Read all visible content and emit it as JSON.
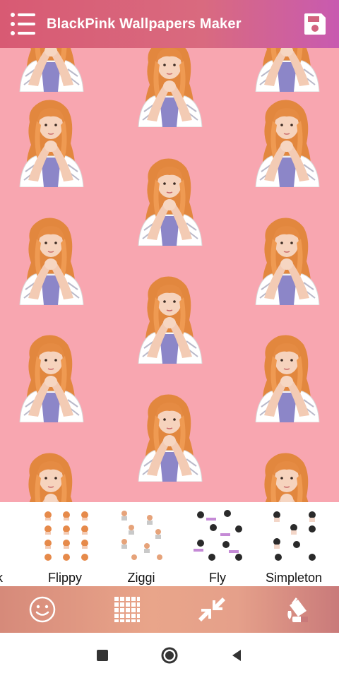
{
  "app": {
    "title": "BlackPink Wallpapers Maker"
  },
  "icons": {
    "menu": "menu-list-icon",
    "save": "save-icon",
    "stickers": "smiley-icon",
    "grid": "grid-icon",
    "resize": "collapse-arrows-icon",
    "paint": "paint-bucket-icon",
    "nav_recents": "square-icon",
    "nav_home": "circle-icon",
    "nav_back": "triangle-back-icon"
  },
  "colors": {
    "canvas_background": "#f8a6b0",
    "appbar_start": "#d85a73",
    "appbar_end": "#c85ab0",
    "toolbar_start": "#d68a7a",
    "toolbar_end": "#c97a7a"
  },
  "patterns": [
    {
      "label": "k"
    },
    {
      "label": "Flippy"
    },
    {
      "label": "Ziggi"
    },
    {
      "label": "Fly"
    },
    {
      "label": "Simpleton"
    }
  ]
}
